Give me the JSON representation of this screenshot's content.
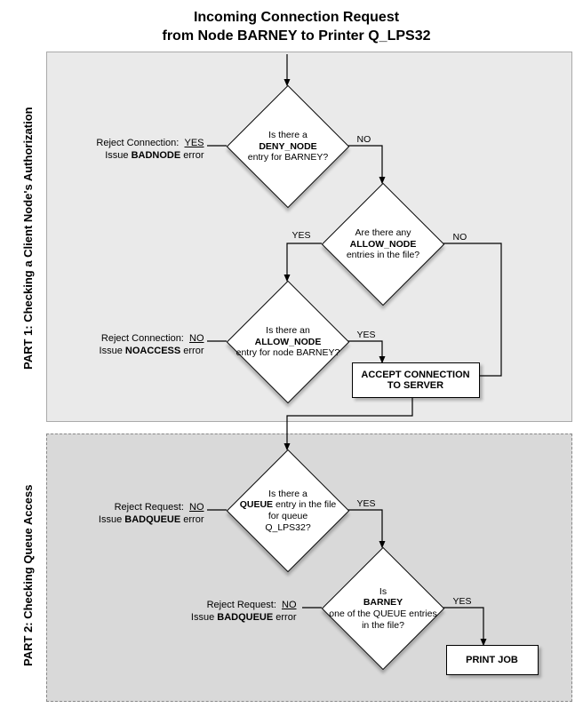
{
  "title_line1": "Incoming Connection Request",
  "title_line2": "from Node BARNEY to Printer Q_LPS32",
  "part1_label": "PART 1: Checking a Client Node's Authorization",
  "part2_label": "PART 2: Checking Queue Access",
  "d1": {
    "pre": "Is there a",
    "bold": "DENY_NODE",
    "post": "entry for BARNEY?"
  },
  "d2": {
    "pre": "Are there any",
    "bold": "ALLOW_NODE",
    "post": "entries in the file?"
  },
  "d3": {
    "pre": "Is there an",
    "bold": "ALLOW_NODE",
    "post": "entry for node BARNEY?"
  },
  "d4": {
    "pre": "Is there a",
    "bold": "QUEUE",
    "post1": "entry in the file for queue",
    "post2": "Q_LPS32?"
  },
  "d5": {
    "pre": "Is",
    "bold": "BARNEY",
    "post": "one of the QUEUE entries in the file?"
  },
  "reject1": {
    "l1a": "Reject Connection:",
    "l1b": "YES",
    "l2a": "Issue ",
    "l2bold": "BADNODE",
    "l2b": " error"
  },
  "reject2": {
    "l1a": "Reject Connection:",
    "l1b": "NO",
    "l2a": "Issue ",
    "l2bold": "NOACCESS",
    "l2b": " error"
  },
  "reject3": {
    "l1a": "Reject Request:",
    "l1b": "NO",
    "l2a": "Issue ",
    "l2bold": "BADQUEUE",
    "l2b": " error"
  },
  "reject4": {
    "l1a": "Reject Request:",
    "l1b": "NO",
    "l2a": "Issue ",
    "l2bold": "BADQUEUE",
    "l2b": " error"
  },
  "accept_box": "ACCEPT CONNECTION TO SERVER",
  "print_box": "PRINT JOB",
  "labels": {
    "yes": "YES",
    "no": "NO"
  }
}
